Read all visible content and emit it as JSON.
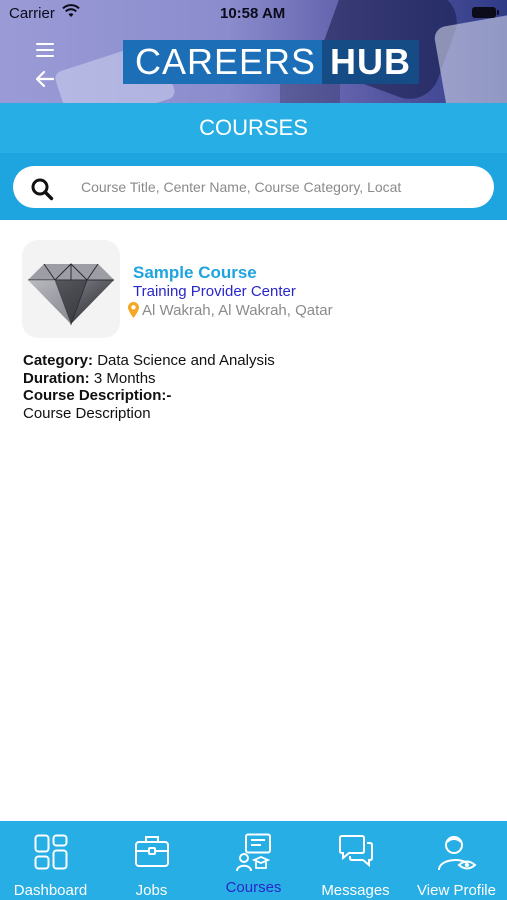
{
  "status_bar": {
    "carrier": "Carrier",
    "time": "10:58 AM"
  },
  "header": {
    "logo_careers": "CAREERS",
    "logo_hub": "HUB",
    "menu_icon": "hamburger-menu-icon",
    "back_icon": "back-arrow-icon"
  },
  "page": {
    "title": "COURSES"
  },
  "search": {
    "placeholder": "Course Title, Center Name, Course Category, Locat",
    "value": ""
  },
  "courses": [
    {
      "title": "Sample Course",
      "center": "Training Provider Center",
      "location": "Al Wakrah, Al Wakrah, Qatar",
      "category_label": "Category:",
      "category": "Data Science and Analysis",
      "duration_label": "Duration:",
      "duration": "3 Months",
      "description_label": "Course Description:-",
      "description": "Course Description"
    }
  ],
  "tabs": [
    {
      "label": "Dashboard",
      "icon": "dashboard-icon",
      "active": false
    },
    {
      "label": "Jobs",
      "icon": "briefcase-icon",
      "active": false
    },
    {
      "label": "Courses",
      "icon": "courses-icon",
      "active": true
    },
    {
      "label": "Messages",
      "icon": "chat-bubbles-icon",
      "active": false
    },
    {
      "label": "View Profile",
      "icon": "profile-eye-icon",
      "active": false
    }
  ],
  "colors": {
    "header_blue": "#27aee4",
    "search_blue": "#1ea4de",
    "course_title": "#1ea4de",
    "center_link": "#2a27c8",
    "active_tab": "#2a27c8",
    "pin": "#f5a623"
  }
}
